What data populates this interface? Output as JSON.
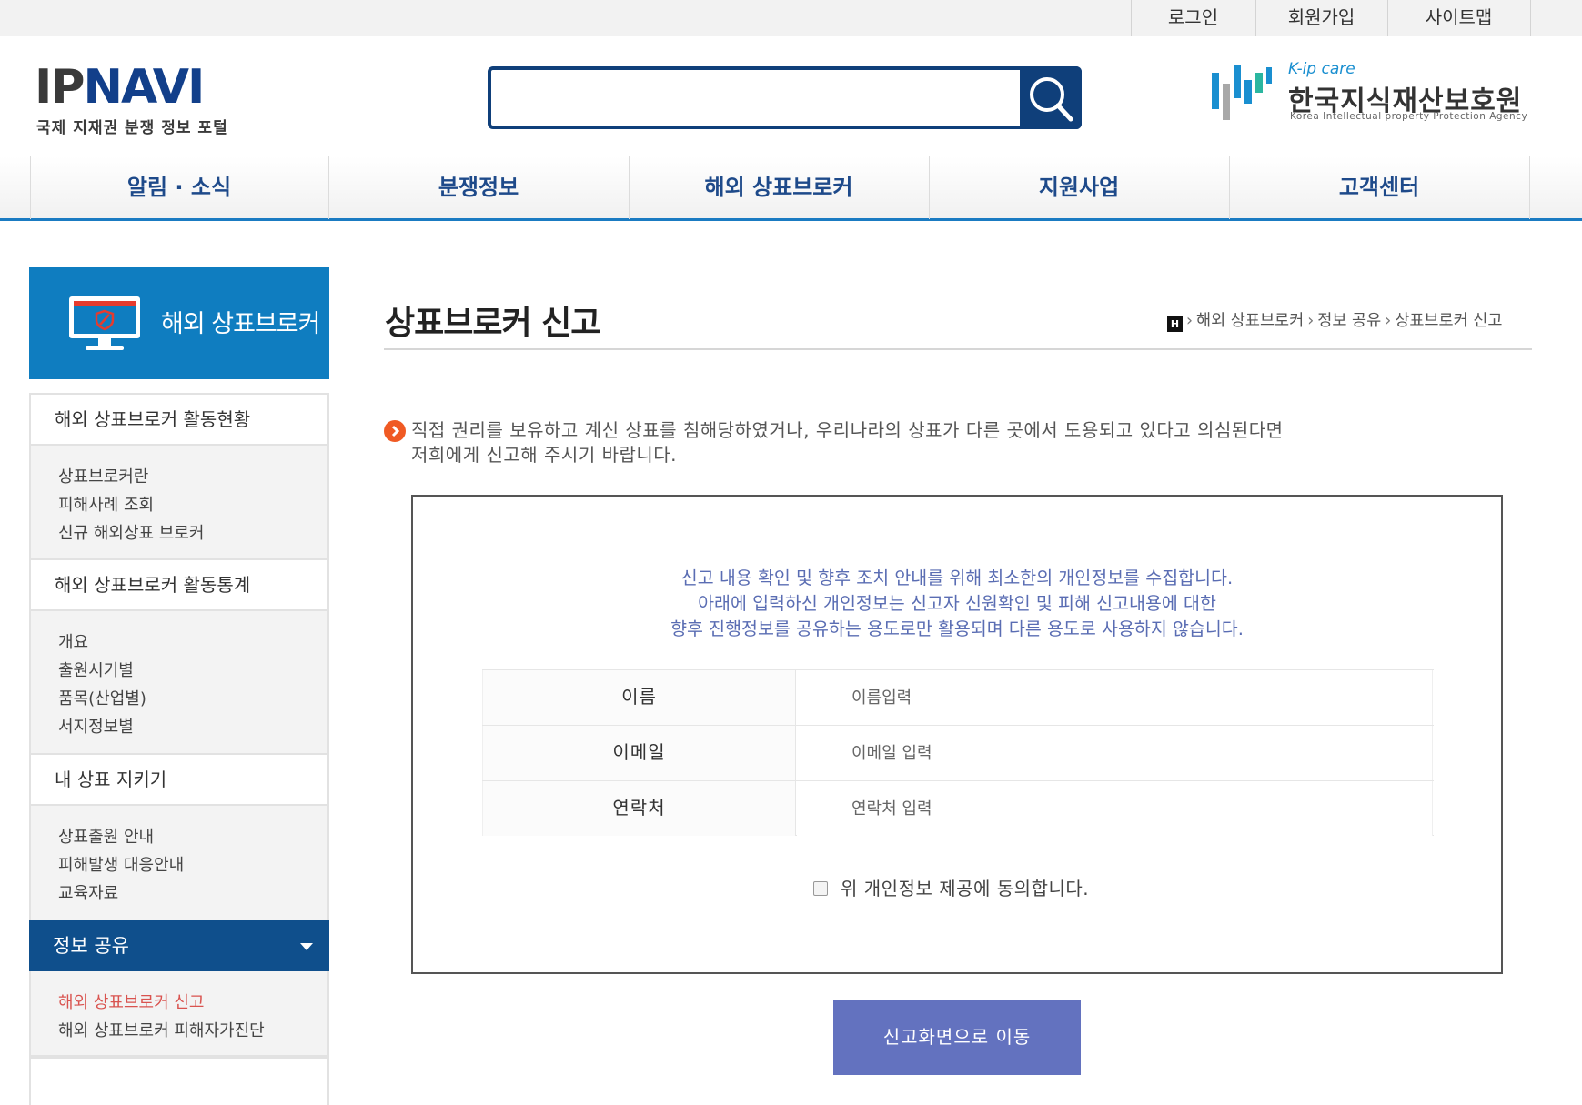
{
  "util": {
    "login": "로그인",
    "signup": "회원가입",
    "sitemap": "사이트맵"
  },
  "logo": {
    "ip": "IP",
    "navi": "NAVI",
    "subtitle": "국제 지재권 분쟁 정보 포털"
  },
  "search": {
    "placeholder": "",
    "icon": "search-icon"
  },
  "agency": {
    "brand": "K-ip care",
    "name": "한국지식재산보호원",
    "english": "Korea Intellectual property Protection Agency"
  },
  "gnb": {
    "items": [
      "알림 · 소식",
      "분쟁정보",
      "해외 상표브로커",
      "지원사업",
      "고객센터"
    ]
  },
  "sidebar": {
    "banner_title": "해외 상표브로커",
    "groups": [
      {
        "label": "해외 상표브로커 활동현황",
        "items": [
          "상표브로커란",
          "피해사례 조회",
          "신규 해외상표 브로커"
        ]
      },
      {
        "label": "해외 상표브로커 활동통계",
        "items": [
          "개요",
          "출원시기별",
          "품목(산업별)",
          "서지정보별"
        ]
      },
      {
        "label": "내 상표 지키기",
        "items": [
          "상표출원 안내",
          "피해발생 대응안내",
          "교육자료"
        ]
      },
      {
        "label": "정보 공유",
        "items": [
          "해외 상표브로커 신고",
          "해외 상표브로커 피해자가진단"
        ]
      }
    ],
    "active_item_color": "#d9534f"
  },
  "page": {
    "title": "상표브로커 신고",
    "breadcrumb": [
      "해외 상표브로커",
      "정보 공유",
      "상표브로커 신고"
    ],
    "home_label": "H",
    "notice_line1": "직접 권리를 보유하고 계신 상표를 침해당하였거나, 우리나라의 상표가 다른 곳에서 도용되고 있다고 의심된다면",
    "notice_line2": "저희에게 신고해 주시기 바랍니다."
  },
  "form": {
    "message": [
      "신고 내용 확인 및 향후 조치 안내를 위해 최소한의 개인정보를 수집합니다.",
      "아래에 입력하신 개인정보는 신고자 신원확인 및 피해 신고내용에 대한",
      "향후 진행정보를 공유하는 용도로만 활용되며 다른 용도로 사용하지 않습니다."
    ],
    "fields": [
      {
        "label": "이름",
        "placeholder": "이름입력"
      },
      {
        "label": "이메일",
        "placeholder": "이메일 입력"
      },
      {
        "label": "연락처",
        "placeholder": "연락처 입력"
      }
    ],
    "agree_label": "위 개인정보 제공에 동의합니다.",
    "submit_label": "신고화면으로 이동"
  },
  "colors": {
    "primary": "#0f3f7a",
    "nav_text": "#1e4a8a",
    "banner": "#0f7dc0",
    "button": "#6372bf",
    "notice_icon": "#f05a23"
  }
}
